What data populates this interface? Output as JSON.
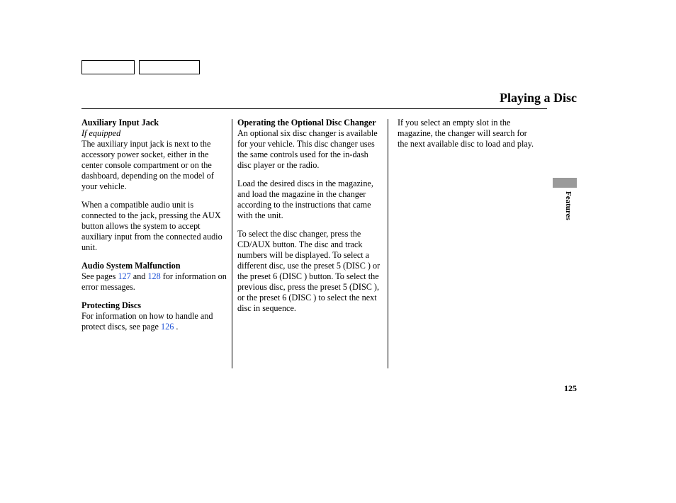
{
  "title": "Playing a Disc",
  "section_tab": "Features",
  "page_number": "125",
  "col1": {
    "h1": "Auxiliary Input Jack",
    "h1_sub": "If equipped",
    "p1": "The auxiliary input jack is next to the accessory power socket, either in the center console compartment or on the dashboard, depending on the model of your vehicle.",
    "p2": "When a compatible audio unit is connected to the jack, pressing the AUX button allows the system to accept auxiliary input from the connected audio unit.",
    "h2": "Audio System Malfunction",
    "p3a": "See pages ",
    "link_127": "127",
    "p3b": " and ",
    "link_128": "128",
    "p3c": " for information on error messages.",
    "h3": "Protecting Discs",
    "p4a": "For information on how to handle and protect discs, see page ",
    "link_126": "126",
    "p4b": " ."
  },
  "col2": {
    "h1": "Operating the Optional Disc Changer",
    "p1": "An optional six disc changer is available for your vehicle. This disc changer uses the same controls used for the in-dash disc player or the radio.",
    "p2": "Load the desired discs in the magazine, and load the magazine in the changer according to the instructions that came with the unit.",
    "p3": "To select the disc changer, press the CD/AUX button. The disc and track numbers will be displayed. To select a different disc, use the preset 5 (DISC     ) or the preset 6 (DISC     ) button. To select the previous disc, press the preset 5 (DISC     ), or the preset 6 (DISC     ) to select the next disc in sequence."
  },
  "col3": {
    "p1": "If you select an empty slot in the magazine, the changer will search for the next available disc to load and play."
  }
}
